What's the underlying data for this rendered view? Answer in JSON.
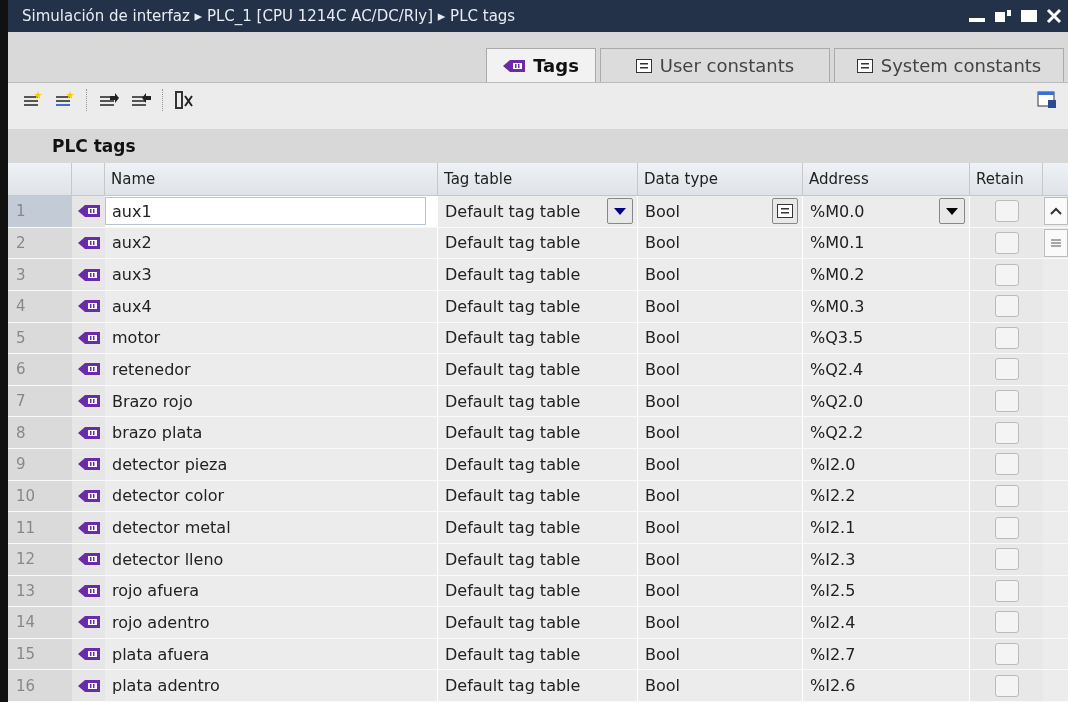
{
  "window": {
    "title": "Simulación de interfaz ▸ PLC_1 [CPU 1214C AC/DC/Rly] ▸ PLC tags"
  },
  "tabs": [
    {
      "label": "Tags",
      "selected": true
    },
    {
      "label": "User constants",
      "selected": false
    },
    {
      "label": "System constants",
      "selected": false
    }
  ],
  "section_title": "PLC tags",
  "table": {
    "columns": [
      "Name",
      "Tag table",
      "Data type",
      "Address",
      "Retain"
    ],
    "rows": [
      {
        "number": "1",
        "name": "aux1",
        "tag_table": "Default tag table",
        "data_type": "Bool",
        "address": "%M0.0",
        "retain": false,
        "selected": true
      },
      {
        "number": "2",
        "name": "aux2",
        "tag_table": "Default tag table",
        "data_type": "Bool",
        "address": "%M0.1",
        "retain": false,
        "selected": false
      },
      {
        "number": "3",
        "name": "aux3",
        "tag_table": "Default tag table",
        "data_type": "Bool",
        "address": "%M0.2",
        "retain": false,
        "selected": false
      },
      {
        "number": "4",
        "name": "aux4",
        "tag_table": "Default tag table",
        "data_type": "Bool",
        "address": "%M0.3",
        "retain": false,
        "selected": false
      },
      {
        "number": "5",
        "name": "motor",
        "tag_table": "Default tag table",
        "data_type": "Bool",
        "address": "%Q3.5",
        "retain": false,
        "selected": false
      },
      {
        "number": "6",
        "name": "retenedor",
        "tag_table": "Default tag table",
        "data_type": "Bool",
        "address": "%Q2.4",
        "retain": false,
        "selected": false
      },
      {
        "number": "7",
        "name": "Brazo rojo",
        "tag_table": "Default tag table",
        "data_type": "Bool",
        "address": "%Q2.0",
        "retain": false,
        "selected": false
      },
      {
        "number": "8",
        "name": "brazo plata",
        "tag_table": "Default tag table",
        "data_type": "Bool",
        "address": "%Q2.2",
        "retain": false,
        "selected": false
      },
      {
        "number": "9",
        "name": "detector pieza",
        "tag_table": "Default tag table",
        "data_type": "Bool",
        "address": "%I2.0",
        "retain": false,
        "selected": false
      },
      {
        "number": "10",
        "name": "detector color",
        "tag_table": "Default tag table",
        "data_type": "Bool",
        "address": "%I2.2",
        "retain": false,
        "selected": false
      },
      {
        "number": "11",
        "name": "detector metal",
        "tag_table": "Default tag table",
        "data_type": "Bool",
        "address": "%I2.1",
        "retain": false,
        "selected": false
      },
      {
        "number": "12",
        "name": "detector lleno",
        "tag_table": "Default tag table",
        "data_type": "Bool",
        "address": "%I2.3",
        "retain": false,
        "selected": false
      },
      {
        "number": "13",
        "name": "rojo afuera",
        "tag_table": "Default tag table",
        "data_type": "Bool",
        "address": "%I2.5",
        "retain": false,
        "selected": false
      },
      {
        "number": "14",
        "name": "rojo adentro",
        "tag_table": "Default tag table",
        "data_type": "Bool",
        "address": "%I2.4",
        "retain": false,
        "selected": false
      },
      {
        "number": "15",
        "name": "plata afuera",
        "tag_table": "Default tag table",
        "data_type": "Bool",
        "address": "%I2.7",
        "retain": false,
        "selected": false
      },
      {
        "number": "16",
        "name": "plata adentro",
        "tag_table": "Default tag table",
        "data_type": "Bool",
        "address": "%I2.6",
        "retain": false,
        "selected": false
      }
    ]
  }
}
